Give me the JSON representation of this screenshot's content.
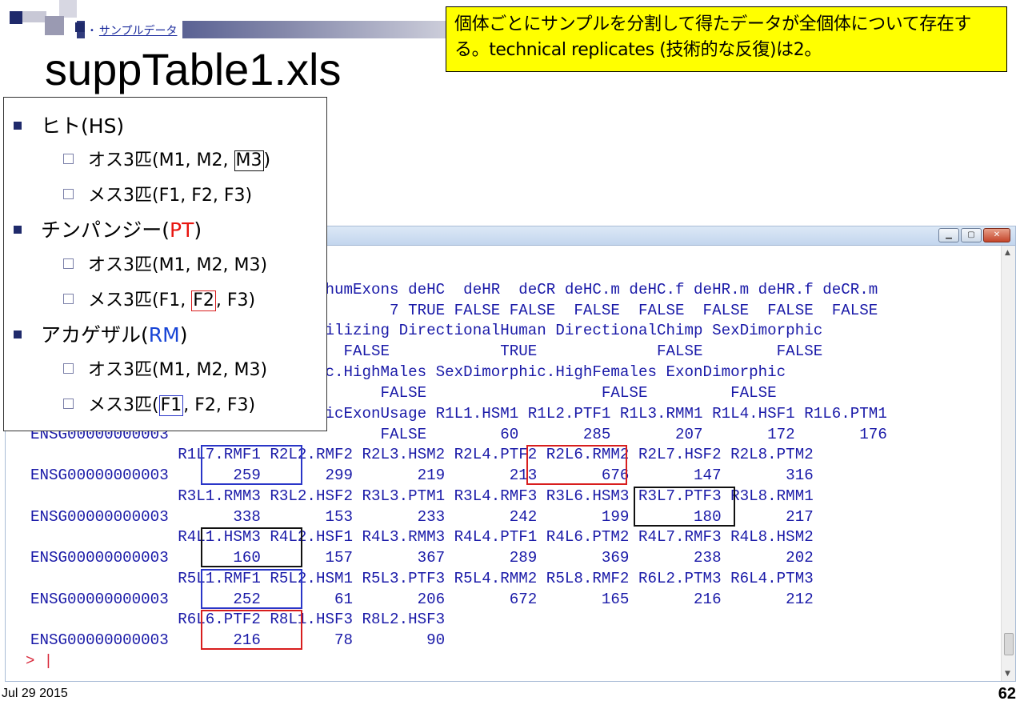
{
  "slide": {
    "breadcrumb": "サンプルデータ",
    "title": "suppTable1.xls",
    "note": "個体ごとにサンプルを分割して得たデータが全個体について存在する。technical replicates (技術的な反復)は2。",
    "date": "Jul 29 2015",
    "page": "62"
  },
  "legend": {
    "human": {
      "name": "ヒト",
      "code": "(HS)"
    },
    "human_male": {
      "label": "オス3匹(M1, M2, ",
      "boxed": "M3",
      "end": ")"
    },
    "human_female": "メス3匹(F1, F2, F3)",
    "chimp": {
      "name": "チンパンジー(",
      "code": "PT",
      "end": ")"
    },
    "chimp_male": "オス3匹(M1, M2, M3)",
    "chimp_female": {
      "label": "メス3匹(F1, ",
      "boxed": "F2",
      "end": ", F3)"
    },
    "macaque": {
      "name": "アカゲザル(",
      "code": "RM",
      "end": ")"
    },
    "macaque_male": "オス3匹(M1, M2, M3)",
    "macaque_female": {
      "label": "メス3匹(",
      "boxed": "F1",
      "end": ", F2, F3)"
    }
  },
  "console": {
    "lines": [
      "                                humExons deHC  deHR  deCR deHC.m deHC.f deHR.m deHR.f deCR.m",
      "                                       7 TRUE FALSE FALSE  FALSE  FALSE  FALSE  FALSE  FALSE",
      "                                ilizing DirectionalHuman DirectionalChimp SexDimorphic",
      "                                  FALSE            TRUE             FALSE        FALSE",
      "                                c.HighMales SexDimorphic.HighFemales ExonDimorphic",
      "                                      FALSE                   FALSE         FALSE",
      "                                icExonUsage R1L1.HSM1 R1L2.PTF1 R1L3.RMM1 R1L4.HSF1 R1L6.PTM1",
      "ENSG00000000003                       FALSE        60       285       207       172       176",
      "                R1L7.RMF1 R2L2.RMF2 R2L3.HSM2 R2L4.PTF2 R2L6.RMM2 R2L7.HSF2 R2L8.PTM2",
      "ENSG00000000003       259       299       219       213       676       147       316",
      "                R3L1.RMM3 R3L2.HSF2 R3L3.PTM1 R3L4.RMF3 R3L6.HSM3 R3L7.PTF3 R3L8.RMM1",
      "ENSG00000000003       338       153       233       242       199       180       217",
      "                R4L1.HSM3 R4L2.HSF1 R4L3.RMM3 R4L4.PTF1 R4L6.PTM2 R4L7.RMF3 R4L8.HSM2",
      "ENSG00000000003       160       157       367       289       369       238       202",
      "                R5L1.RMF1 R5L2.HSM1 R5L3.PTF3 R5L4.RMM2 R5L8.RMF2 R6L2.PTM3 R6L4.PTM3",
      "ENSG00000000003       252        61       206       672       165       216       212",
      "                R6L6.PTF2 R8L1.HSF3 R8L2.HSF3",
      "ENSG00000000003       216        78        90"
    ],
    "prompt": "> |"
  }
}
